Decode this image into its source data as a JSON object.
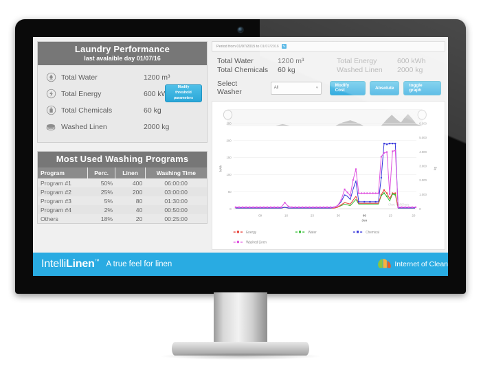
{
  "monitor": {
    "webcam_icon": "webcam-icon"
  },
  "summary": {
    "title": "Laundry Performance",
    "subtitle": "last avalaible day 01/07/16",
    "threshold_button": {
      "line1": "Modify",
      "line2": "threshold",
      "line3": "parameters"
    },
    "rows": [
      {
        "icon": "water-drop-icon",
        "label": "Total Water",
        "value": "1200 m³"
      },
      {
        "icon": "lightning-icon",
        "label": "Total Energy",
        "value": "600 kWh"
      },
      {
        "icon": "chemical-icon",
        "label": "Total Chemicals",
        "value": "60 kg"
      },
      {
        "icon": "linen-stack-icon",
        "label": "Washed Linen",
        "value": "2000 kg"
      }
    ]
  },
  "programs": {
    "title": "Most Used Washing Programs",
    "columns": [
      "Program",
      "Perc.",
      "Linen",
      "Washing Time"
    ],
    "rows": [
      {
        "program": "Program #1",
        "perc": "50%",
        "linen": "400",
        "time": "06:00:00"
      },
      {
        "program": "Program #2",
        "perc": "25%",
        "linen": "200",
        "time": "03:00:00"
      },
      {
        "program": "Program #3",
        "perc": "5%",
        "linen": "80",
        "time": "01:30:00"
      },
      {
        "program": "Program #4",
        "perc": "2%",
        "linen": "40",
        "time": "00:50:00"
      },
      {
        "program": "Others",
        "perc": "18%",
        "linen": "20",
        "time": "00:25:00"
      }
    ]
  },
  "period": {
    "text": "Period from 01/07/2015 to 01/07/2016",
    "edit_icon": "edit-calendar-icon",
    "edit_glyph": "✎"
  },
  "kpis": [
    {
      "label": "Total Water",
      "value": "1200 m³",
      "muted": false
    },
    {
      "label": "Total Energy",
      "value": "600 kWh",
      "muted": true
    },
    {
      "label": "Total Chemicals",
      "value": "60 kg",
      "muted": false
    },
    {
      "label": "Washed Linen",
      "value": "2000 kg",
      "muted": true
    }
  ],
  "controls": {
    "select_washer_label": "Select Washer",
    "washer_value": "All",
    "washer_caret": "▾",
    "buttons": [
      {
        "label": "Modify Cost",
        "name": "modify-cost-button"
      },
      {
        "label": "Absolute",
        "name": "absolute-button"
      },
      {
        "label": "toggle graph",
        "name": "toggle-graph-button"
      }
    ]
  },
  "chart_data": {
    "type": "line",
    "title": "",
    "xlabel": "Jun",
    "ylabel": "kWh",
    "y2label": "kg",
    "ylim": [
      0,
      250
    ],
    "y2lim": [
      0,
      6000
    ],
    "yticks": [
      "0",
      "50",
      "100",
      "150",
      "200",
      "250"
    ],
    "y2ticks": [
      "0",
      "1.000",
      "2.000",
      "3.000",
      "4.000",
      "5.000",
      "6.000"
    ],
    "xticks": [
      "09",
      "16",
      "23",
      "30",
      "06",
      "13",
      "20"
    ],
    "grid": true,
    "legend_position": "bottom",
    "navigator": true,
    "credits": "Chart: IntelliCharts",
    "series": [
      {
        "name": "Energy",
        "color": "#e8453c",
        "axis": "left",
        "values": [
          1,
          1,
          1,
          1,
          1,
          1,
          1,
          1,
          1,
          1,
          1,
          1,
          1,
          1,
          1,
          2,
          1,
          1,
          1,
          1,
          1,
          1,
          1,
          1,
          1,
          1,
          1,
          1,
          1,
          1,
          2,
          5,
          9,
          8,
          7,
          12,
          20,
          9,
          9,
          9,
          9,
          9,
          9,
          9,
          9,
          40,
          55,
          45,
          30,
          45,
          44,
          2,
          1,
          1,
          1,
          1,
          1
        ]
      },
      {
        "name": "Water",
        "color": "#3cc13b",
        "axis": "left",
        "values": [
          1,
          1,
          1,
          1,
          1,
          1,
          1,
          1,
          1,
          1,
          1,
          1,
          1,
          1,
          1,
          2,
          1,
          1,
          1,
          1,
          1,
          1,
          1,
          1,
          1,
          1,
          1,
          1,
          1,
          1,
          2,
          5,
          8,
          7,
          6,
          10,
          15,
          7,
          7,
          7,
          7,
          7,
          7,
          7,
          7,
          38,
          45,
          35,
          22,
          42,
          40,
          2,
          1,
          1,
          1,
          1,
          1
        ]
      },
      {
        "name": "Chemical",
        "color": "#3b3bdc",
        "axis": "left",
        "values": [
          2,
          2,
          2,
          2,
          2,
          2,
          2,
          2,
          2,
          2,
          2,
          2,
          2,
          2,
          2,
          3,
          2,
          2,
          2,
          2,
          2,
          2,
          2,
          2,
          2,
          2,
          2,
          2,
          2,
          2,
          4,
          10,
          20,
          18,
          14,
          28,
          40,
          19,
          19,
          19,
          19,
          19,
          19,
          19,
          19,
          90,
          192,
          188,
          190,
          190,
          192,
          3,
          2,
          2,
          2,
          2,
          2
        ]
      },
      {
        "name": "Washed Linen",
        "color": "#e055e0",
        "axis": "right",
        "values": [
          3,
          3,
          3,
          3,
          3,
          3,
          3,
          3,
          3,
          3,
          3,
          3,
          3,
          3,
          3,
          9,
          4,
          3,
          3,
          3,
          3,
          3,
          3,
          3,
          3,
          3,
          3,
          3,
          3,
          3,
          6,
          14,
          28,
          24,
          20,
          40,
          56,
          22,
          22,
          22,
          22,
          22,
          22,
          22,
          22,
          148,
          205,
          208,
          45,
          210,
          212,
          4,
          3,
          3,
          3,
          3,
          3
        ]
      }
    ]
  },
  "footer": {
    "brand_prefix": "Intelli",
    "brand_suffix": "Linen",
    "brand_tm": "™",
    "tagline": "A true feel for linen",
    "partner_text": "Internet of Clean",
    "partner_logo_icon": "internet-of-clean-logo-icon"
  },
  "colors": {
    "accent": "#29abe2",
    "panel_header": "#777777",
    "table_header": "#8b8b8b",
    "energy": "#e8453c",
    "water": "#3cc13b",
    "chemical": "#3b3bdc",
    "linen": "#e055e0"
  }
}
